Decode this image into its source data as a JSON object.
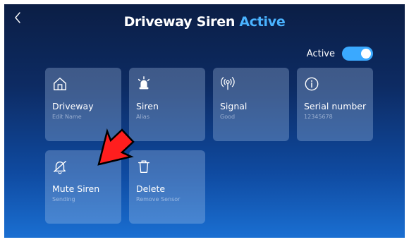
{
  "header": {
    "back_icon": "chevron-left-icon",
    "title": "Driveway Siren",
    "status": "Active"
  },
  "toggle": {
    "label": "Active",
    "on": true
  },
  "tiles": [
    {
      "icon": "home-icon",
      "label": "Driveway",
      "sub": "Edit Name"
    },
    {
      "icon": "siren-icon",
      "label": "Siren",
      "sub": "Alias"
    },
    {
      "icon": "signal-icon",
      "label": "Signal",
      "sub": "Good"
    },
    {
      "icon": "info-icon",
      "label": "Serial number",
      "sub": "12345678"
    },
    {
      "icon": "bell-off-icon",
      "label": "Mute Siren",
      "sub": "Sending"
    },
    {
      "icon": "trash-icon",
      "label": "Delete",
      "sub": "Remove Sensor"
    }
  ],
  "colors": {
    "accent": "#4ab3ff",
    "toggle_on": "#3aa9ff",
    "annotation_arrow": "#ff1e1e"
  }
}
